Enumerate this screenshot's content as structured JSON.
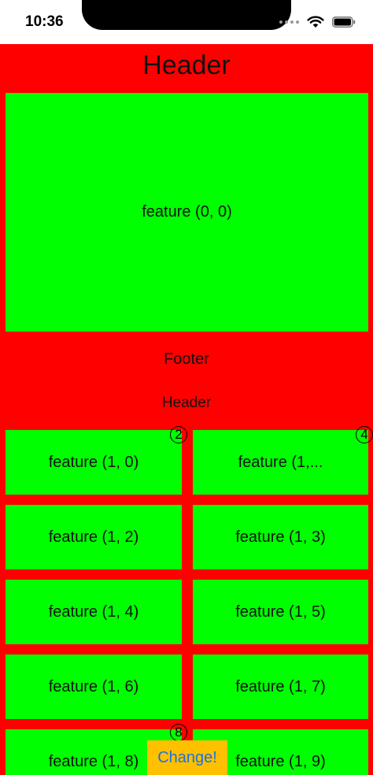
{
  "status_bar": {
    "time": "10:36",
    "icons": [
      "signal-dots-icon",
      "wifi-icon",
      "battery-icon"
    ]
  },
  "section0": {
    "header": "Header",
    "footer": "Footer",
    "cell": "feature (0, 0)"
  },
  "section1": {
    "header": "Header",
    "cells": [
      "feature (1, 0)",
      "feature (1,...",
      "feature (1, 2)",
      "feature (1, 3)",
      "feature (1, 4)",
      "feature (1, 5)",
      "feature (1, 6)",
      "feature (1, 7)",
      "feature (1, 8)",
      "feature (1, 9)"
    ],
    "badges": [
      "2",
      "4",
      "8"
    ]
  },
  "change_button": {
    "label": "Change!"
  },
  "colors": {
    "background": "#ff0000",
    "cell": "#00ff00",
    "button": "#ffc000",
    "button_text": "#1e73d6"
  }
}
